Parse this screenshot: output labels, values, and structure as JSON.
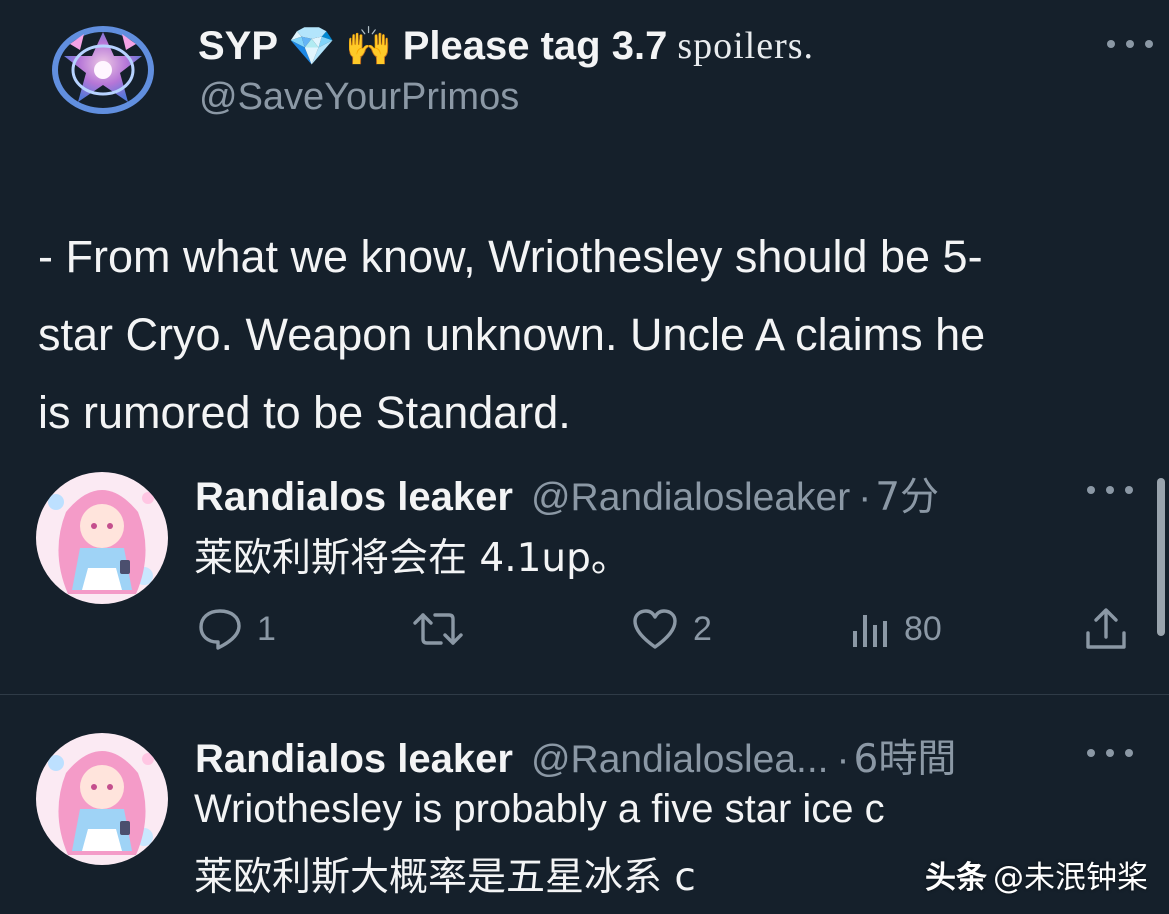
{
  "main_tweet": {
    "name": "SYP",
    "name_emojis": [
      "💎",
      "🙌"
    ],
    "name_suffix_bold": "Please tag 3.7",
    "name_suffix_serif": "spoilers.",
    "handle": "@SaveYourPrimos",
    "body": "- From what we know, Wriothesley should be 5-\nstar Cryo. Weapon unknown. Uncle A claims he\nis rumored to be Standard."
  },
  "reply1": {
    "name": "Randialos leaker",
    "handle": "@Randialosleaker",
    "separator": "·",
    "time": "7分",
    "text": "莱欧利斯将会在 4.1up。",
    "actions": {
      "reply_count": "1",
      "retweet_count": "",
      "like_count": "2",
      "views_count": "80"
    }
  },
  "reply2": {
    "name": "Randialos leaker",
    "handle": "@Randialoslea...",
    "separator": "·",
    "time": "6時間",
    "text_line1": "Wriothesley is probably a five star ice c",
    "text_line2": "莱欧利斯大概率是五星冰系 c"
  },
  "watermark": {
    "brand": "头条",
    "account": "@未泯钟桨"
  },
  "colors": {
    "background": "#15202b",
    "text_primary": "#f3f4f5",
    "text_secondary": "#8b98a5",
    "divider": "#2f3b47"
  },
  "icons": [
    "more-dots-icon",
    "reply-bubble-icon",
    "retweet-icon",
    "heart-icon",
    "views-bars-icon",
    "share-icon"
  ]
}
